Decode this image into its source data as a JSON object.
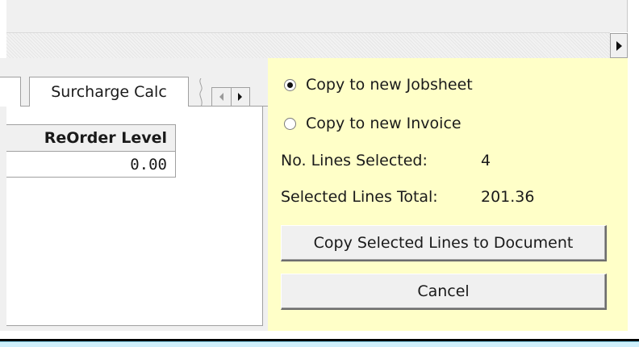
{
  "tabs": {
    "surcharge_calc": "Surcharge Calc"
  },
  "grid": {
    "column_header": "ReOrder Level",
    "cell_value": "0.00"
  },
  "copy_panel": {
    "option_jobsheet": "Copy to new Jobsheet",
    "option_invoice": "Copy to new Invoice",
    "selected_option": "Copy to new Jobsheet",
    "lines_selected_label": "No. Lines Selected:",
    "lines_selected_value": "4",
    "total_label": "Selected Lines Total:",
    "total_value": "201.36",
    "copy_button_label": "Copy Selected Lines to Document",
    "cancel_button_label": "Cancel",
    "background_color": "#ffffc8"
  },
  "icons": {
    "scroll_right": "triangle-right-icon",
    "tab_scroll_left": "triangle-left-icon",
    "tab_scroll_right": "triangle-right-icon"
  }
}
